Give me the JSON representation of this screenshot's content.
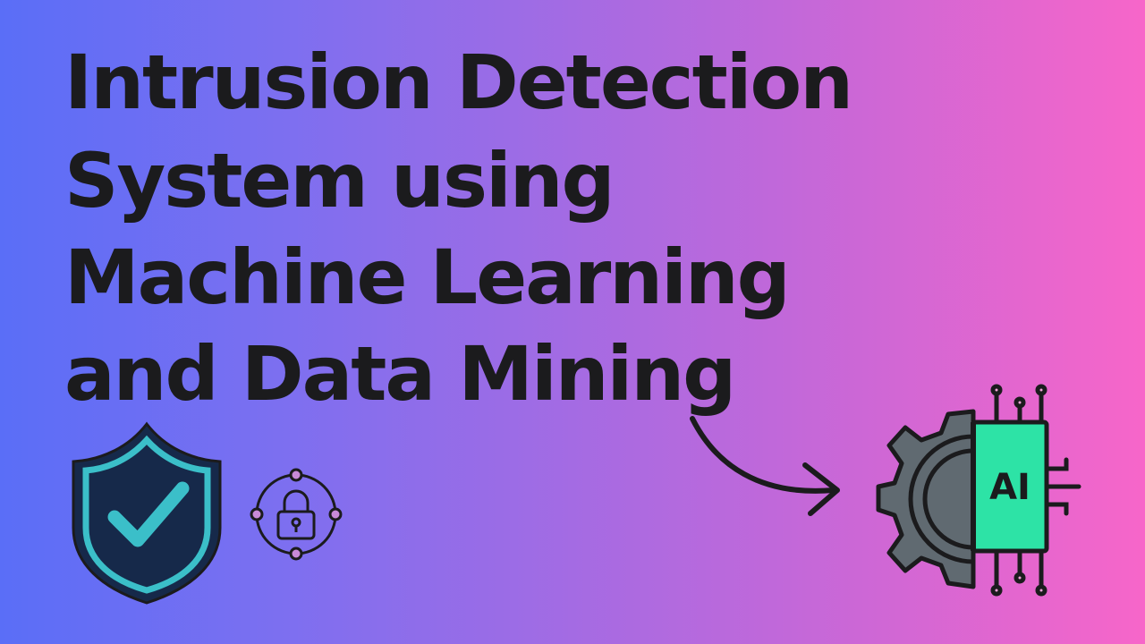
{
  "title": {
    "lines": [
      "Intrusion Detection",
      "System using",
      "Machine Learning",
      "and Data Mining"
    ]
  },
  "icons": {
    "shield": "shield-check-icon",
    "padlock": "network-lock-icon",
    "arrow": "curved-arrow-icon",
    "chip": "ai-gear-chip-icon"
  },
  "chip": {
    "label": "AI"
  },
  "colors": {
    "gradient_start": "#5a6ef7",
    "gradient_end": "#f766c9",
    "text": "#1b1b1d",
    "shield_fill": "#16294a",
    "accent_teal": "#3bbfc9",
    "chip_green": "#2de3a6",
    "gear_gray": "#606a71"
  }
}
